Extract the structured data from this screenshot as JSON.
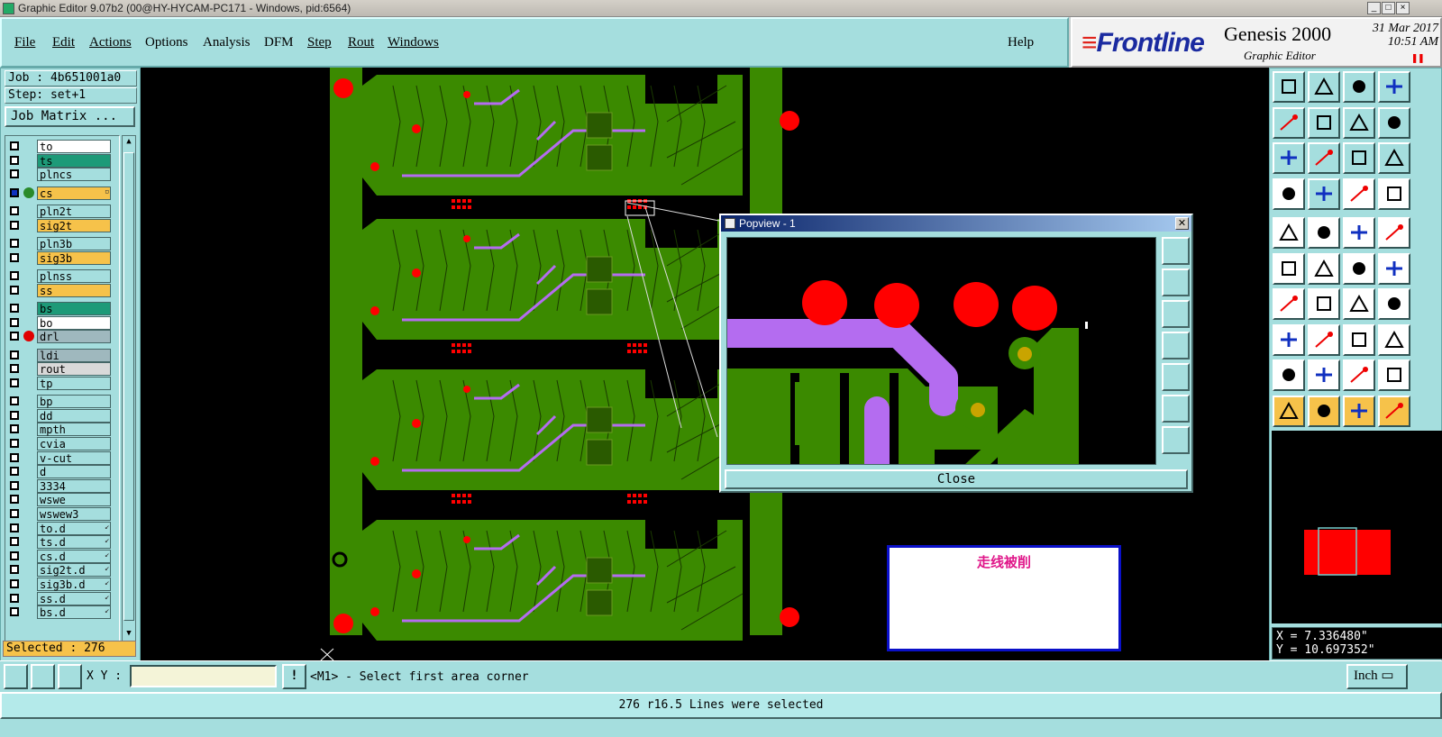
{
  "window": {
    "title": "Graphic Editor 9.07b2 (00@HY-HYCAM-PC171 - Windows, pid:6564)"
  },
  "menu": [
    "File",
    "Edit",
    "Actions",
    "Options",
    "Analysis",
    "DFM",
    "Step",
    "Rout",
    "Windows"
  ],
  "help_label": "Help",
  "brand": {
    "logo": "Frontline",
    "product": "Genesis 2000",
    "subtitle": "Graphic Editor",
    "date": "31 Mar 2017",
    "time": "10:51 AM"
  },
  "job": {
    "job_label": "Job : 4b651001a0",
    "step_label": "Step: set+1",
    "job_matrix_button": "Job Matrix ..."
  },
  "layers": [
    {
      "name": "to",
      "color": "#ffffff"
    },
    {
      "name": "ts",
      "color": "#1d9a78"
    },
    {
      "name": "plncs",
      "color": "#a5dede"
    },
    {
      "name": "cs",
      "color": "#f6c24a",
      "active": true
    },
    {
      "name": "pln2t",
      "color": "#a5dede"
    },
    {
      "name": "sig2t",
      "color": "#f6c24a"
    },
    {
      "name": "pln3b",
      "color": "#a5dede"
    },
    {
      "name": "sig3b",
      "color": "#f6c24a"
    },
    {
      "name": "plnss",
      "color": "#a5dede"
    },
    {
      "name": "ss",
      "color": "#f6c24a"
    },
    {
      "name": "bs",
      "color": "#1d9a78"
    },
    {
      "name": "bo",
      "color": "#ffffff"
    },
    {
      "name": "drl",
      "color": "#9fb8be",
      "dot": "#e00000"
    },
    {
      "name": "ldi",
      "color": "#9fb8be"
    },
    {
      "name": "rout",
      "color": "#d9d9d9"
    },
    {
      "name": "tp",
      "color": "#a5dede"
    },
    {
      "name": "bp",
      "color": "#a5dede"
    },
    {
      "name": "dd",
      "color": "#a5dede"
    },
    {
      "name": "mpth",
      "color": "#a5dede"
    },
    {
      "name": "cvia",
      "color": "#a5dede"
    },
    {
      "name": "v-cut",
      "color": "#a5dede"
    },
    {
      "name": "d",
      "color": "#a5dede"
    },
    {
      "name": "3334",
      "color": "#a5dede"
    },
    {
      "name": "wswe",
      "color": "#a5dede"
    },
    {
      "name": "wswew3",
      "color": "#a5dede"
    },
    {
      "name": "to.d",
      "color": "#a5dede",
      "linked": true
    },
    {
      "name": "ts.d",
      "color": "#a5dede",
      "linked": true
    },
    {
      "name": "cs.d",
      "color": "#a5dede",
      "linked": true
    },
    {
      "name": "sig2t.d",
      "color": "#a5dede",
      "linked": true
    },
    {
      "name": "sig3b.d",
      "color": "#a5dede",
      "linked": true
    },
    {
      "name": "ss.d",
      "color": "#a5dede",
      "linked": true
    },
    {
      "name": "bs.d",
      "color": "#a5dede",
      "linked": true
    }
  ],
  "selected_label": "Selected : 276",
  "popview": {
    "title": "Popview - 1",
    "close_label": "Close"
  },
  "annotation": {
    "text": "走线被削"
  },
  "coords": {
    "x": "X = 7.336480\"",
    "y": "Y = 10.697352\""
  },
  "command": {
    "xy_label": "X Y :",
    "xy_value": "",
    "prompt": "<M1> - Select first area corner",
    "units": "Inch"
  },
  "status": "276 r16.5 Lines were selected",
  "colors": {
    "panel": "#a5dede",
    "board": "#3b8a00",
    "pad": "#ff0000",
    "trace_highlight": "#b46cf0",
    "accent_layer": "#f6c24a"
  }
}
